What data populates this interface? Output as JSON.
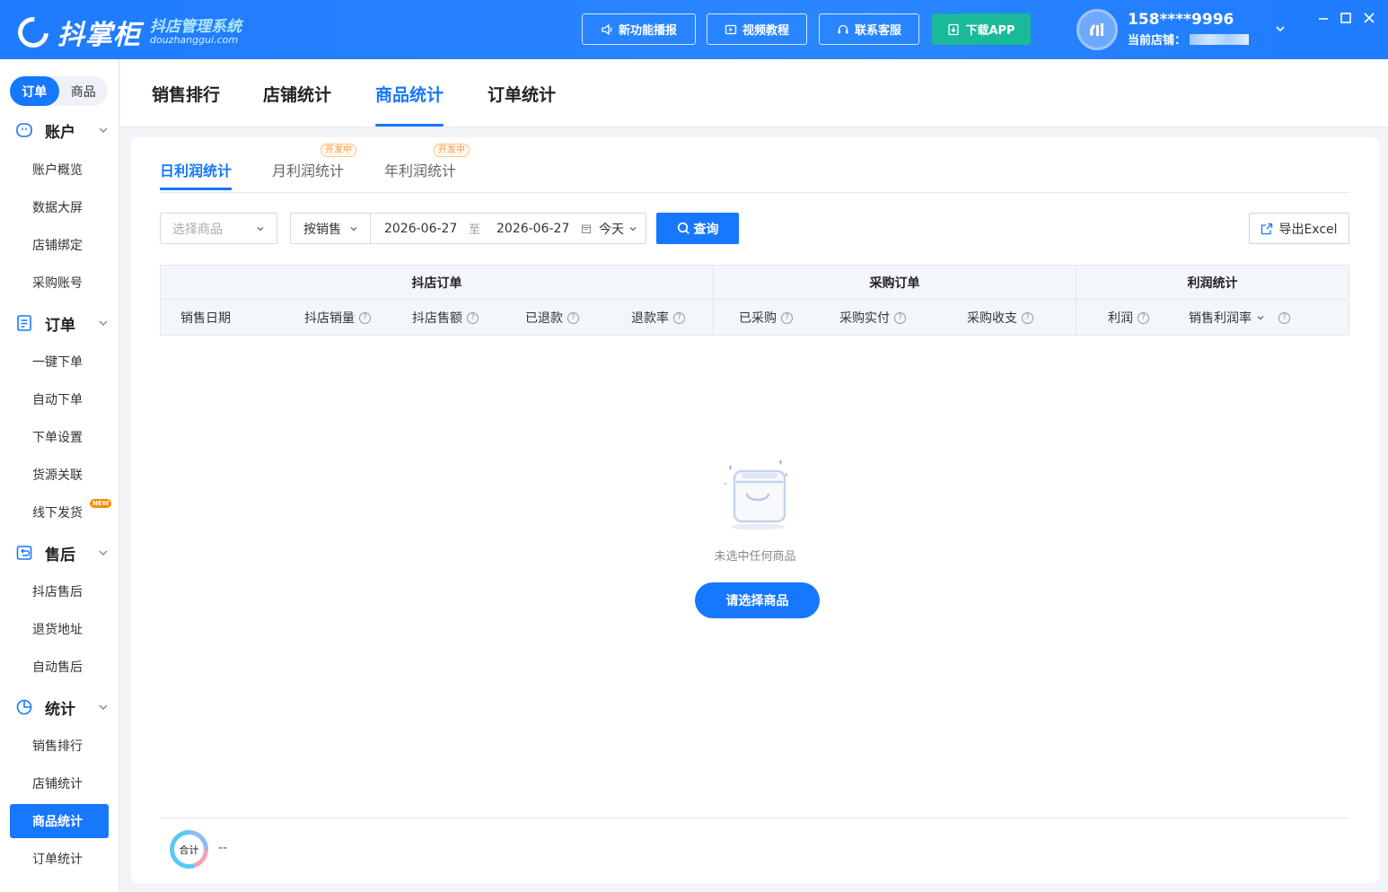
{
  "app": {
    "name": "抖掌柜",
    "subtitle": "抖店管理系统",
    "domain": "douzhanggui.com"
  },
  "toolbar": {
    "news_label": "新功能播报",
    "video_label": "视频教程",
    "service_label": "联系客服",
    "download_label": "下载APP"
  },
  "user": {
    "phone": "158****9996",
    "shop_label": "当前店铺："
  },
  "sidebar": {
    "segments": [
      "订单",
      "商品"
    ],
    "groups": [
      {
        "title": "账户",
        "items": [
          "账户概览",
          "数据大屏",
          "店铺绑定",
          "采购账号"
        ]
      },
      {
        "title": "订单",
        "items": [
          "一键下单",
          "自动下单",
          "下单设置",
          "货源关联",
          "线下发货"
        ]
      },
      {
        "title": "售后",
        "items": [
          "抖店售后",
          "退货地址",
          "自动售后"
        ]
      },
      {
        "title": "统计",
        "items": [
          "销售排行",
          "店铺统计",
          "商品统计",
          "订单统计"
        ]
      }
    ],
    "new_badge": "NEW",
    "active_item": "商品统计"
  },
  "top_tabs": [
    "销售排行",
    "店铺统计",
    "商品统计",
    "订单统计"
  ],
  "active_top_tab": "商品统计",
  "sub_tabs": [
    {
      "label": "日利润统计",
      "tag": ""
    },
    {
      "label": "月利润统计",
      "tag": "开发中"
    },
    {
      "label": "年利润统计",
      "tag": "开发中"
    }
  ],
  "filters": {
    "product_placeholder": "选择商品",
    "mode": "按销售",
    "date_start": "2026-06-27",
    "date_sep": "至",
    "date_end": "2026-06-27",
    "date_preset": "今天",
    "query_label": "查询",
    "export_label": "导出Excel"
  },
  "table": {
    "groups": [
      "抖店订单",
      "采购订单",
      "利润统计"
    ],
    "columns": [
      "销售日期",
      "抖店销量",
      "抖店售额",
      "已退款",
      "退款率",
      "已采购",
      "采购实付",
      "采购收支",
      "利润",
      "销售利润率"
    ]
  },
  "empty": {
    "text": "未选中任何商品",
    "button_label": "请选择商品"
  },
  "footer": {
    "total_label": "合计",
    "total_value": "--"
  },
  "colors": {
    "primary": "#1677ff",
    "download_btn": "#19b99a",
    "dev_tag": "#ff9a3c"
  }
}
